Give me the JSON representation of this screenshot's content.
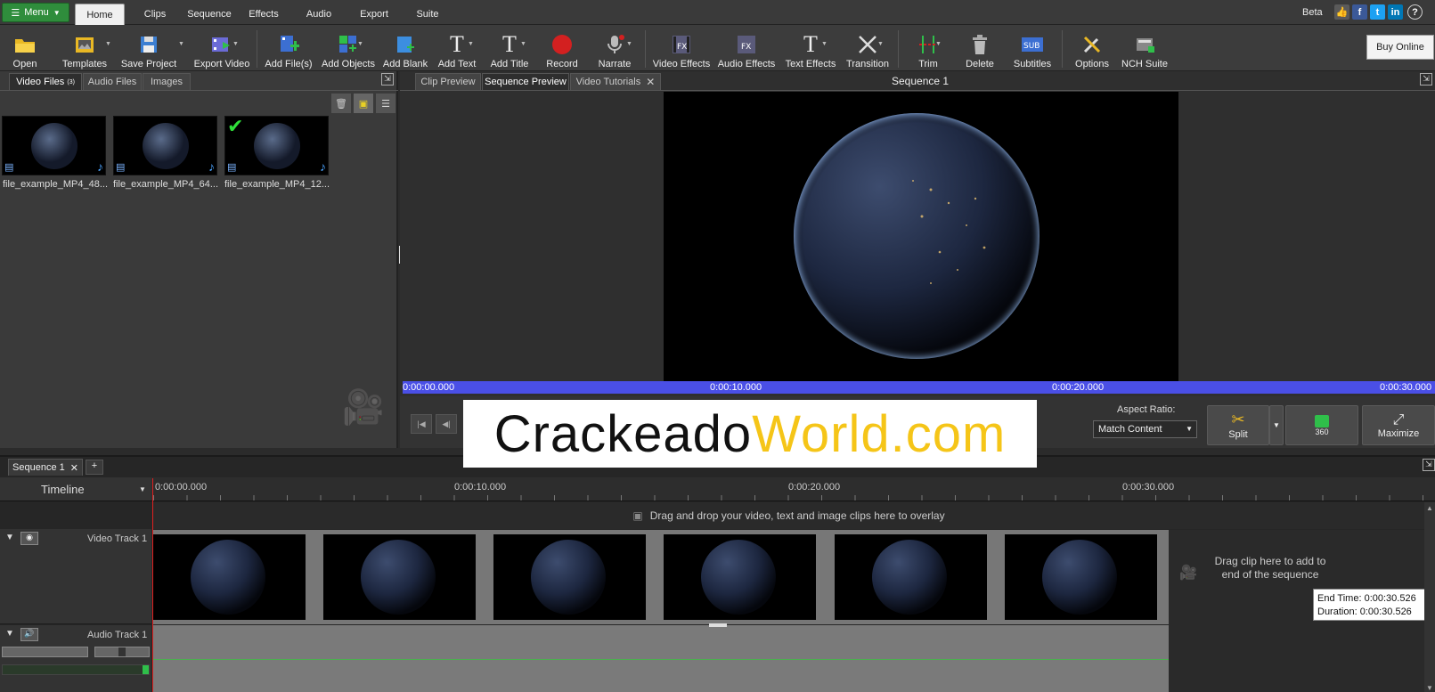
{
  "menubar": {
    "menu_label": "Menu",
    "tabs": [
      {
        "label": "Home",
        "active": true
      },
      {
        "label": "Clips"
      },
      {
        "label": "Sequence"
      },
      {
        "label": "Effects"
      },
      {
        "label": "Audio"
      },
      {
        "label": "Export"
      },
      {
        "label": "Suite"
      }
    ],
    "beta": "Beta",
    "social": [
      "like-icon",
      "facebook-icon",
      "twitter-icon",
      "linkedin-icon",
      "help-icon"
    ]
  },
  "toolbar": {
    "items": [
      {
        "label": "Open",
        "icon": "folder-icon"
      },
      {
        "label": "Templates",
        "icon": "templates-icon"
      },
      {
        "label": "Save Project",
        "icon": "save-icon"
      },
      {
        "label": "Export Video",
        "icon": "export-video-icon"
      },
      {
        "label": "Add File(s)",
        "icon": "add-file-icon"
      },
      {
        "label": "Add Objects",
        "icon": "add-objects-icon"
      },
      {
        "label": "Add Blank",
        "icon": "add-blank-icon"
      },
      {
        "label": "Add Text",
        "icon": "add-text-icon"
      },
      {
        "label": "Add Title",
        "icon": "add-title-icon"
      },
      {
        "label": "Record",
        "icon": "record-icon"
      },
      {
        "label": "Narrate",
        "icon": "microphone-icon"
      },
      {
        "label": "Video Effects",
        "icon": "video-fx-icon"
      },
      {
        "label": "Audio Effects",
        "icon": "audio-fx-icon"
      },
      {
        "label": "Text Effects",
        "icon": "text-fx-icon"
      },
      {
        "label": "Transition",
        "icon": "transition-icon"
      },
      {
        "label": "Trim",
        "icon": "trim-icon"
      },
      {
        "label": "Delete",
        "icon": "trash-icon"
      },
      {
        "label": "Subtitles",
        "icon": "subtitles-icon"
      },
      {
        "label": "Options",
        "icon": "options-icon"
      },
      {
        "label": "NCH Suite",
        "icon": "nch-suite-icon"
      }
    ],
    "buy_online": "Buy Online"
  },
  "media": {
    "tabs": [
      {
        "label": "Video Files",
        "badge": "(3)",
        "active": true
      },
      {
        "label": "Audio Files"
      },
      {
        "label": "Images"
      }
    ],
    "files": [
      {
        "name": "file_example_MP4_48..."
      },
      {
        "name": "file_example_MP4_64..."
      },
      {
        "name": "file_example_MP4_12..."
      }
    ]
  },
  "preview": {
    "tabs": [
      {
        "label": "Clip Preview"
      },
      {
        "label": "Sequence Preview",
        "active": true
      },
      {
        "label": "Video Tutorials"
      }
    ],
    "title": "Sequence 1",
    "scrub_times": [
      "0:00:00.000",
      "0:00:10.000",
      "0:00:20.000",
      "0:00:30.000"
    ],
    "aspect_label": "Aspect Ratio:",
    "aspect_value": "Match Content",
    "split": "Split",
    "three60": "360",
    "maximize": "Maximize"
  },
  "watermark": {
    "part1": "Crackeado",
    "part2": "World",
    "part3": ".com",
    "color1": "#111111",
    "color2": "#f5c518"
  },
  "timeline": {
    "tab": "Sequence 1",
    "add": "+",
    "timeline_label": "Timeline",
    "ruler": [
      "0:00:00.000",
      "0:00:10.000",
      "0:00:20.000",
      "0:00:30.000"
    ],
    "overlay_hint": "Drag and drop your video, text and image clips here to overlay",
    "video_track": "Video Track 1",
    "audio_track": "Audio Track 1",
    "drop_hint": "Drag clip here to add to end of the sequence",
    "end_time": "End Time: 0:00:30.526",
    "duration": "Duration: 0:00:30.526"
  }
}
